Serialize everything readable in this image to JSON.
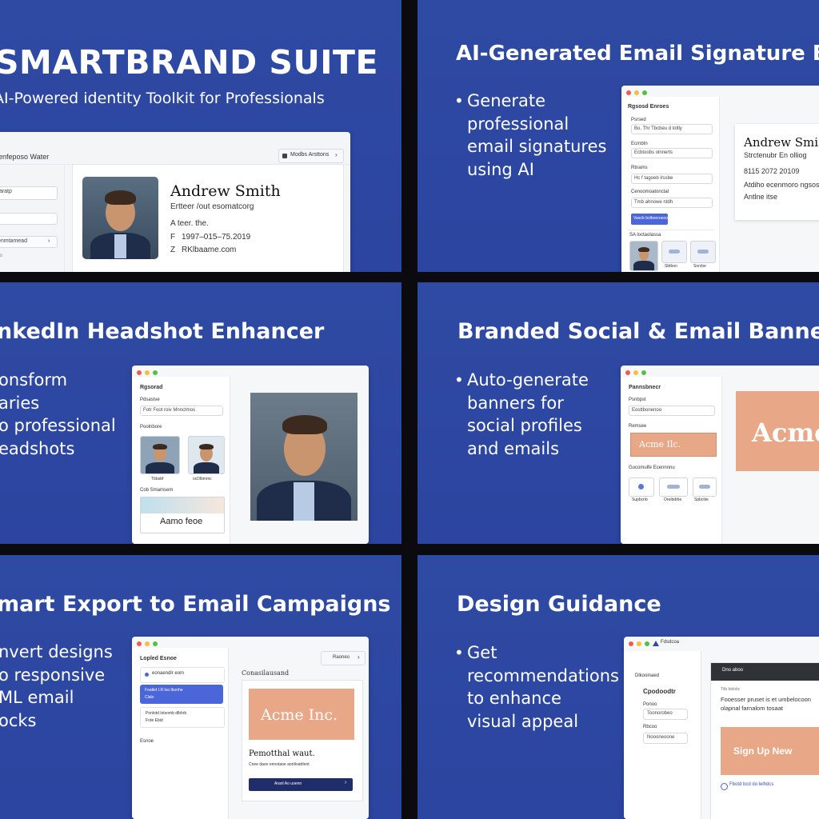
{
  "colors": {
    "slide_bg": "#2f4aa3",
    "banner": "#e8a888",
    "primary_button": "#4a66d8",
    "dark_button": "#1f2d6b"
  },
  "slide1": {
    "title": "SMARTBRAND SUITE",
    "subtitle": "AI-Powered identity Toolkit for Professionals",
    "app": {
      "toolbar_title": "enfeposo Water",
      "toolbar_button": "Modbs Arsttons",
      "fields": [
        "taratp",
        "",
        "enmtamead"
      ],
      "card": {
        "name": "Andrew Smith",
        "line1": "Ertteer /out esomatcorg",
        "line2": "A teer. the.",
        "phone_icon": "F",
        "phone": "1997–015–75.2019",
        "web_icon": "Z",
        "web": "RKlbaame.com"
      }
    }
  },
  "slide2": {
    "title": "AI-Generated Email Signature Bu",
    "bullets": [
      "Generate",
      "professional",
      "email signatures",
      "using AI"
    ],
    "app": {
      "panel_title": "Rgsosd Enroes",
      "labels": [
        "Psrsed",
        "Ecrnbtn",
        "Rtnams",
        "Cenoomoatonctal",
        "SA loctaolassa"
      ],
      "fields": [
        "Bo. Thr Tbcbeu d loltly",
        "Ecbtoobs olnnerts",
        "Hc f tagoeb lrssbe",
        "Tmb ahnowe ntdh"
      ],
      "button": "Vaecb bolboeroeoo",
      "thumb_labels": [
        "",
        "Sbtbon",
        "Sorcbe"
      ],
      "card": {
        "name": "Andrew Smi",
        "line1": "Strctenubr En olliog",
        "line2": "8115 2072 20109",
        "line3": "Atdiho ecenmoro ngsos",
        "line4": "Antlne itse"
      }
    }
  },
  "slide3": {
    "title": "nkedIn Headshot Enhancer",
    "bullets": [
      "onsform",
      "aries",
      "o professional",
      "eadshots"
    ],
    "app": {
      "panel_title": "Rgsorad",
      "label1": "Pdsastve",
      "field1": "Fotr Foot roiv Mnnctmos",
      "label2": "Poolnbore",
      "thumb_labels": [
        "Tbbsbf",
        "ocDlbmmc"
      ],
      "label3": "Cob Smamsem",
      "logo_text": "Aamo feoe"
    }
  },
  "slide4": {
    "title": "Branded Social & Email Banners",
    "bullets": [
      "Auto-generate",
      "banners for",
      "social profiles",
      "and emails"
    ],
    "app": {
      "panel_title": "Pannsbnecr",
      "label1": "Psnbpst",
      "field1": "Eosttbonenoo",
      "label2": "Remsee",
      "banner_small": "Acme Ilc.",
      "label3": "Gucomulfe Ecennnnu",
      "icon_labels": [
        "Supbcnb",
        "Oreibdrbe",
        "Spbcitie"
      ],
      "banner_large": "Acme"
    }
  },
  "slide5": {
    "title": "mart Export to Email Campaigns",
    "bullets": [
      "nvert designs",
      "o responsive",
      "ML email",
      "ocks"
    ],
    "app": {
      "panel_title": "Lopled Esnoe",
      "item1": "eonaendlr eom",
      "selected_line1": "Foatlet I.R loo lbonhe",
      "selected_line2": "Clalo",
      "item3_line1": "Ponlotd lotsomb dlbhrb",
      "item3_line2": "Frde Ebid",
      "label_bottom": "Esnoe",
      "toolbar_button": "Raoneo",
      "canvas_title": "Conasilausand",
      "banner": "Acme Inc.",
      "heading": "Pemotthal waut.",
      "subline": "Cnee daoo ennotaoe aonltoatrlent",
      "button": "Aranl Ao uoenn"
    }
  },
  "slide6": {
    "title": "Design Guidance",
    "bullets": [
      "Get",
      "recommendations",
      "to enhance",
      "visual appeal"
    ],
    "app": {
      "header_title": "Fdsdcoa",
      "label1": "Dlkooinaed",
      "heading": "Cpodoodtr",
      "label2": "Ponoo",
      "field1": "Toonorobeo",
      "label3": "Rbcoo",
      "field2": "Noooneoone",
      "dark_bar": "Dno aboo",
      "hint_title": "Titb bidobc",
      "hint": "Fooesser pruset is et umbelocoon olapnal farnalom tosaat",
      "cta": "Sign Up New",
      "check": "Fbotd bcd do lelhdcs"
    }
  }
}
